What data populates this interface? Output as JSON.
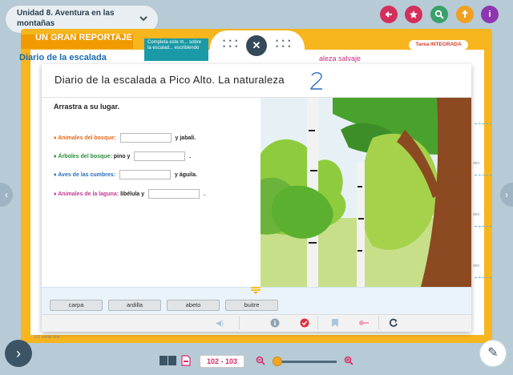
{
  "topbar": {
    "unit_title": "Unidad 8. Aventura en las montañas",
    "buttons": [
      {
        "icon": "back-arrow-icon",
        "color": "#d32f5c"
      },
      {
        "icon": "star-icon",
        "color": "#d32f5c"
      },
      {
        "icon": "search-icon",
        "color": "#3ba06a"
      },
      {
        "icon": "upload-icon",
        "color": "#f0a020"
      },
      {
        "icon": "info-icon",
        "color": "#8e35b0"
      }
    ]
  },
  "book": {
    "header": "UN GRAN REPORTAJE",
    "diario": "Diario de la escalada",
    "teal_note": "Completa este m... sobre la escalad... escribiendo",
    "tarea": "Tarea INTEGRADA",
    "salvaje": "aleza salvaje",
    "side_label": "den.",
    "footer": "102   ciento dos"
  },
  "modal": {
    "title": "Diario de la escalada a Pico Alto. La naturaleza",
    "instruction": "Arrastra a su lugar.",
    "rows": [
      {
        "label": "♦ Animales del bosque:",
        "after": "y jabalí.",
        "color": "#e06a1c"
      },
      {
        "label": "♦ Árboles del bosque:",
        "middle": "pino y",
        "after": ".",
        "color": "#2a8a3a"
      },
      {
        "label": "♦ Aves de las cumbres:",
        "after": "y águila.",
        "color": "#2a6ebb"
      },
      {
        "label": "♦ Animales de la laguna:",
        "middle": "libélula y",
        "after": ".",
        "color": "#c03a92"
      }
    ],
    "word_bank": [
      "carpa",
      "ardilla",
      "abeto",
      "buitre"
    ]
  },
  "bottombar": {
    "pages": "102 - 103"
  },
  "colors": {
    "accent": "#d92b6c",
    "book_frame": "#f7b51e",
    "dark": "#34495a"
  }
}
